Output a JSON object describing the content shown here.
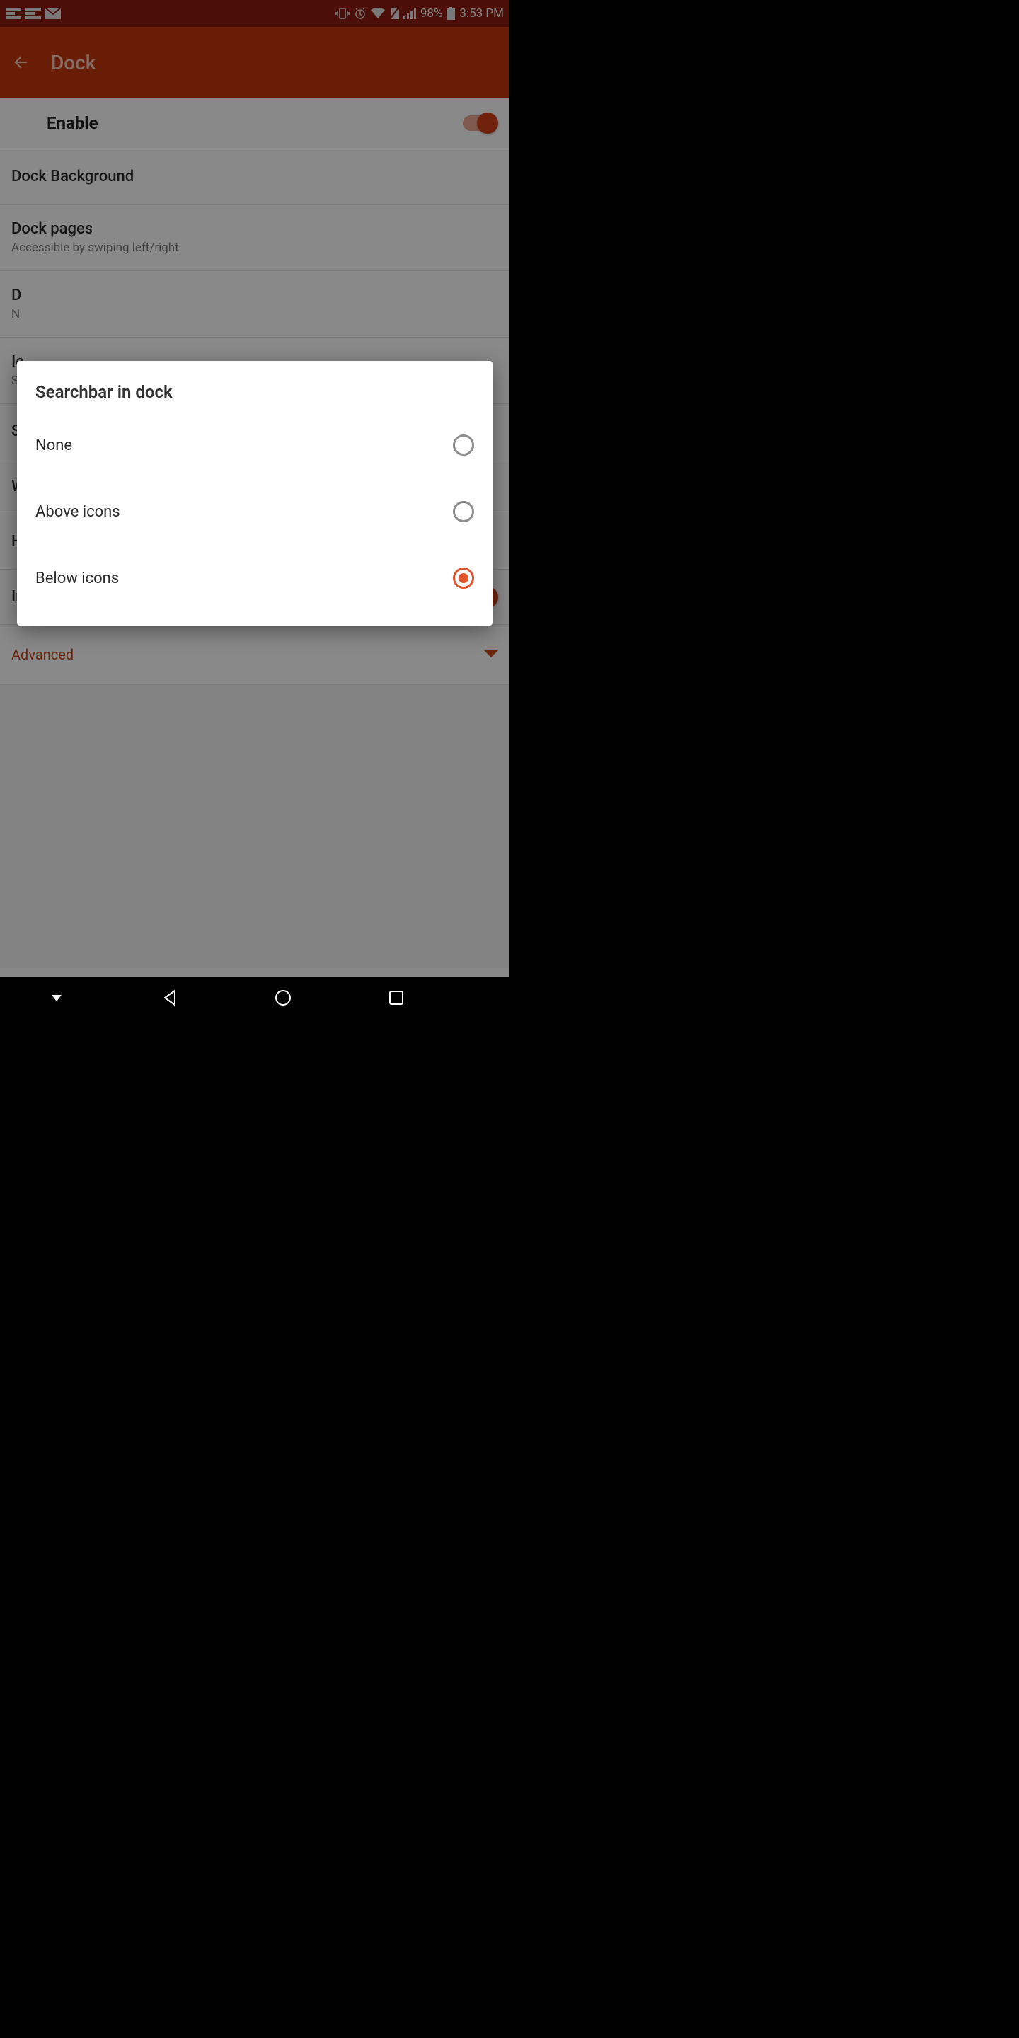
{
  "statusbar": {
    "battery_pct": "98%",
    "time": "3:53 PM"
  },
  "appbar": {
    "title": "Dock"
  },
  "rows": {
    "enable": {
      "title": "Enable"
    },
    "background": {
      "title": "Dock Background"
    },
    "pages": {
      "title": "Dock pages",
      "sub": "Accessible by swiping left/right"
    },
    "stub3": {
      "title": "D",
      "sub": "N"
    },
    "stub4": {
      "title": "Ic",
      "sub": "Si"
    },
    "stub5": {
      "title": "S"
    },
    "stub6": {
      "title": "W"
    },
    "stub7": {
      "title": "H"
    },
    "infinite": {
      "title": "Infinite scroll"
    },
    "advanced": {
      "title": "Advanced"
    }
  },
  "dialog": {
    "title": "Searchbar in dock",
    "options": [
      {
        "label": "None",
        "selected": false
      },
      {
        "label": "Above icons",
        "selected": false
      },
      {
        "label": "Below icons",
        "selected": true
      }
    ]
  }
}
